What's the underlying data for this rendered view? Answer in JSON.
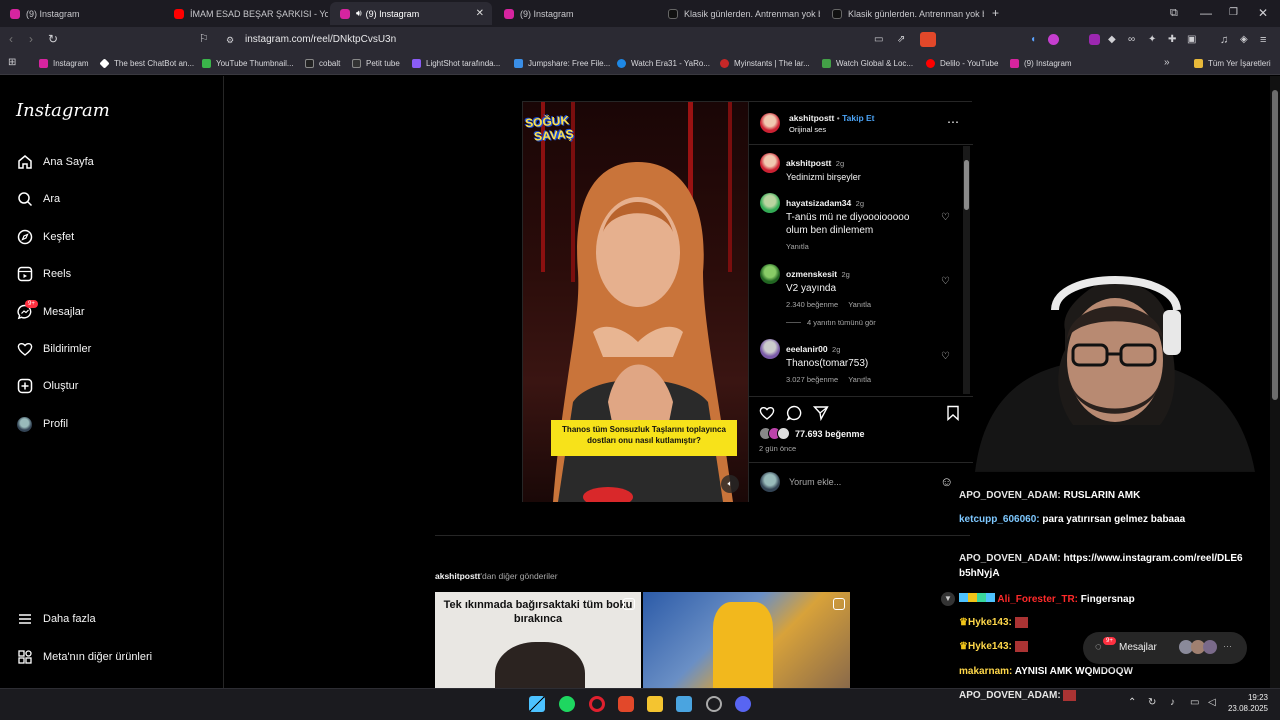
{
  "browser": {
    "tabs": [
      {
        "label": "(9) Instagram",
        "color": "#d6249f"
      },
      {
        "label": "İMAM ESAD BEŞAR ŞARKISI - YouTub",
        "color": "#ff0000"
      },
      {
        "label": "(9) Instagram",
        "color": "#d6249f",
        "active": true
      },
      {
        "label": "(9) Instagram",
        "color": "#d6249f"
      },
      {
        "label": "Klasik günlerden. Antrenman yok bu",
        "color": "#111111"
      },
      {
        "label": "Klasik günlerden. Antrenman yok bu",
        "color": "#111111"
      }
    ],
    "new_tab": "+",
    "url": "instagram.com/reel/DNktpCvsU3n",
    "bookmarks": [
      {
        "label": "Instagram",
        "color": "#d6249f"
      },
      {
        "label": "The best ChatBot an...",
        "color": "#ffffff"
      },
      {
        "label": "YouTube Thumbnail...",
        "color": "#3ab54a"
      },
      {
        "label": "cobalt",
        "color": "#222222"
      },
      {
        "label": "Petit tube",
        "color": "#333333"
      },
      {
        "label": "LightShot tarafında...",
        "color": "#8a5cf6"
      },
      {
        "label": "Jumpshare: Free File...",
        "color": "#3a8ee6"
      },
      {
        "label": "Watch Era31 - YaRo...",
        "color": "#1e88e5"
      },
      {
        "label": "Myinstants | The lar...",
        "color": "#c62828"
      },
      {
        "label": "Watch Global & Loc...",
        "color": "#43a047"
      },
      {
        "label": "Delilo - YouTube",
        "color": "#ff0000"
      },
      {
        "label": "(9) Instagram",
        "color": "#d6249f"
      }
    ],
    "all_bookmarks": "Tüm Yer İşaretleri"
  },
  "instagram": {
    "logo": "Instagram",
    "nav": [
      {
        "label": "Ana Sayfa",
        "icon": "home-icon"
      },
      {
        "label": "Ara",
        "icon": "search-icon"
      },
      {
        "label": "Keşfet",
        "icon": "compass-icon"
      },
      {
        "label": "Reels",
        "icon": "reels-icon"
      },
      {
        "label": "Mesajlar",
        "icon": "messenger-icon",
        "badge": "9+"
      },
      {
        "label": "Bildirimler",
        "icon": "heart-icon"
      },
      {
        "label": "Oluştur",
        "icon": "plus-icon"
      },
      {
        "label": "Profil",
        "icon": "avatar-icon"
      }
    ],
    "more": "Daha fazla",
    "meta_products": "Meta'nın diğer ürünleri"
  },
  "post": {
    "show_logo_line1": "SOĞUK",
    "show_logo_line2": "SAVAŞ",
    "caption_box": "Thanos tüm Sonsuzluk Taşlarını toplayınca dostları onu nasıl kutlamıştır?",
    "author": "akshitpostt",
    "separator": "•",
    "follow": "Takip Et",
    "audio": "Orijinal ses",
    "comments": [
      {
        "user": "akshitpostt",
        "age": "2g",
        "text": "Yedinizmi birşeyler"
      },
      {
        "user": "hayatsizadam34",
        "age": "2g",
        "text": "T-anüs mü ne diyoooiooooo olum ben dinlemem",
        "reply": "Yanıtla"
      },
      {
        "user": "ozmenskesit",
        "age": "2g",
        "text": "V2 yayında",
        "likes": "2.340 beğenme",
        "reply": "Yanıtla",
        "view_replies": "4 yanıtın tümünü gör"
      },
      {
        "user": "eeelanir00",
        "age": "2g",
        "text": "Thanos(tomar753)",
        "likes": "3.027 beğenme",
        "reply": "Yanıtla"
      }
    ],
    "likes": "77.693 beğenme",
    "date": "2 gün önce",
    "comment_placeholder": "Yorum ekle...",
    "more_from": "akshitpostt",
    "more_from_suffix": "'dan diğer gönderiler",
    "thumb1_text": "Tek ıkınmada bağırsaktaki tüm boku bırakınca"
  },
  "chat": [
    {
      "user": "APO_DOVEN_ADAM:",
      "msg": "RUSLARIN AMK",
      "color": "#e6e6e6"
    },
    {
      "user": "ketcupp_606060:",
      "msg": "para yatırırsan gelmez babaaa",
      "color": "#7ec8ff"
    },
    {
      "user": "APO_DOVEN_ADAM:",
      "msg": "https://www.instagram.com/reel/DLE6",
      "msg2": "b5hNyjA",
      "color": "#e6e6e6"
    },
    {
      "user": "Ali_Forester_TR:",
      "msg": "Fingersnap",
      "color": "#ff2a2a"
    },
    {
      "user": "Hyke143:",
      "msg": "",
      "color": "#ffd84a"
    },
    {
      "user": "Hyke143:",
      "msg": "",
      "color": "#ffd84a"
    },
    {
      "user": "makarnam:",
      "msg": "AYNISI AMK WQMDOQW",
      "color": "#ffd84a"
    },
    {
      "user": "APO_DOVEN_ADAM:",
      "msg": "",
      "color": "#e6e6e6"
    }
  ],
  "messages_widget": {
    "label": "Mesajlar",
    "badge": "9+"
  },
  "taskbar": {
    "time": "19:23",
    "date": "23.08.2025"
  }
}
